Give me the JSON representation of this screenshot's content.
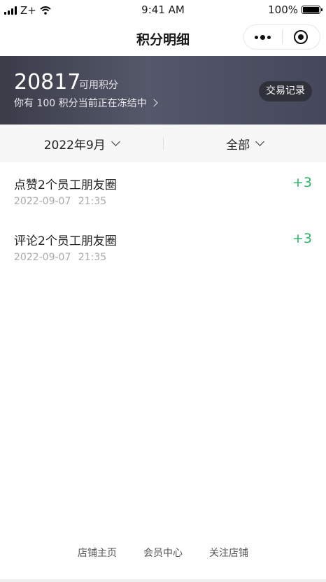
{
  "status_bar": {
    "carrier": "Z+",
    "time": "9:41 AM",
    "battery": "100%"
  },
  "nav": {
    "title": "积分明细"
  },
  "summary": {
    "points": "20817",
    "points_label": "可用积分",
    "frozen_text": "你有 100 积分当前正在冻结中",
    "transactions_button": "交易记录"
  },
  "filters": {
    "month": "2022年9月",
    "type": "全部"
  },
  "records": [
    {
      "title": "点赞2个员工朋友圈",
      "time": "2022-09-07 21:35",
      "points": "+3"
    },
    {
      "title": "评论2个员工朋友圈",
      "time": "2022-09-07 21:35",
      "points": "+3"
    }
  ],
  "footer": {
    "links": [
      "店铺主页",
      "会员中心",
      "关注店铺"
    ]
  },
  "colors": {
    "accent_green": "#2bb56a",
    "banner": "#45475a"
  }
}
